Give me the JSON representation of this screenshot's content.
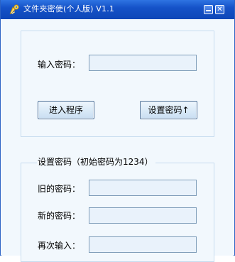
{
  "window": {
    "title": "文件夹密使(个人版) V1.1",
    "minimize_icon": "minimize-icon",
    "close_icon": "close-icon",
    "app_icon": "key-folder-icon"
  },
  "login": {
    "password_label": "输入密码：",
    "password_value": "",
    "enter_button": "进入程序",
    "set_password_button": "设置密码↑"
  },
  "set_password": {
    "legend": "设置密码（初始密码为1234）",
    "old_label": "旧的密码：",
    "old_value": "",
    "new_label": "新的密码：",
    "new_value": "",
    "confirm_label": "再次输入：",
    "confirm_value": ""
  },
  "colors": {
    "titlebar": "#1552c8",
    "client_bg": "#f2f8fd",
    "field_bg": "#e9f2fb",
    "field_border": "#7f9db9"
  }
}
